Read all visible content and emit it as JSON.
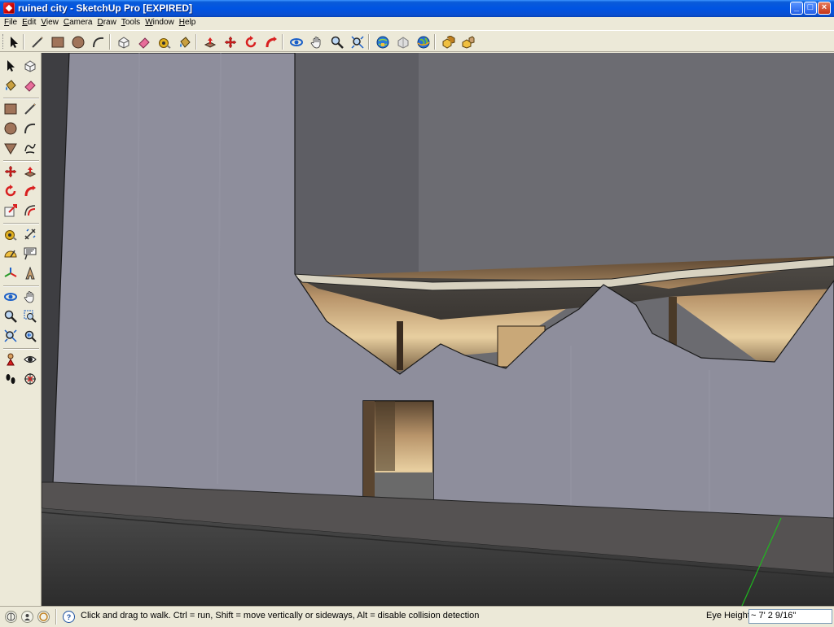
{
  "window": {
    "title": "ruined city - SketchUp Pro [EXPIRED]",
    "minimize_glyph": "_",
    "maximize_glyph": "□",
    "close_glyph": "×"
  },
  "menu": [
    {
      "label": "File"
    },
    {
      "label": "Edit"
    },
    {
      "label": "View"
    },
    {
      "label": "Camera"
    },
    {
      "label": "Draw"
    },
    {
      "label": "Tools"
    },
    {
      "label": "Window"
    },
    {
      "label": "Help"
    }
  ],
  "toolbar_top": [
    "select-icon",
    "line-icon",
    "rectangle-icon",
    "circle-icon",
    "arc-icon",
    "make-component-icon",
    "eraser-icon",
    "tape-measure-icon",
    "paint-bucket-icon",
    "push-pull-icon",
    "move-icon",
    "rotate-icon",
    "follow-me-icon",
    "orbit-icon",
    "pan-icon",
    "zoom-icon",
    "zoom-extents-icon",
    "get-models-icon",
    "share-model-icon",
    "google-earth-icon",
    "make-component-alt-icon",
    "components-icon"
  ],
  "toolbar_left": [
    "select-icon",
    "make-component-icon",
    "paint-bucket-icon",
    "eraser-icon",
    "rectangle-icon",
    "line-icon",
    "circle-icon",
    "arc-icon",
    "polygon-icon",
    "freehand-icon",
    "move-icon",
    "push-pull-icon",
    "rotate-icon",
    "follow-me-icon",
    "scale-icon",
    "offset-icon",
    "tape-measure-icon",
    "dimension-icon",
    "protractor-icon",
    "text-icon",
    "axes-icon",
    "3d-text-icon",
    "orbit-icon",
    "pan-icon",
    "zoom-icon",
    "zoom-window-icon",
    "zoom-extents-icon",
    "previous-view-icon",
    "position-camera-icon",
    "look-around-icon",
    "walk-icon",
    "section-plane-icon"
  ],
  "status": {
    "hint": "Click and drag to walk.  Ctrl = run, Shift = move vertically or sideways, Alt =  disable collision detection",
    "help_glyph": "?",
    "eye_height_label": "Eye Height",
    "eye_height_value": "~ 7' 2 9/16\""
  },
  "colors": {
    "titlebar": "#0054e3",
    "chrome": "#ece9d8",
    "wall": "#8c8c9a",
    "interior": "#c9a878",
    "ground": "#3a3a3a"
  }
}
